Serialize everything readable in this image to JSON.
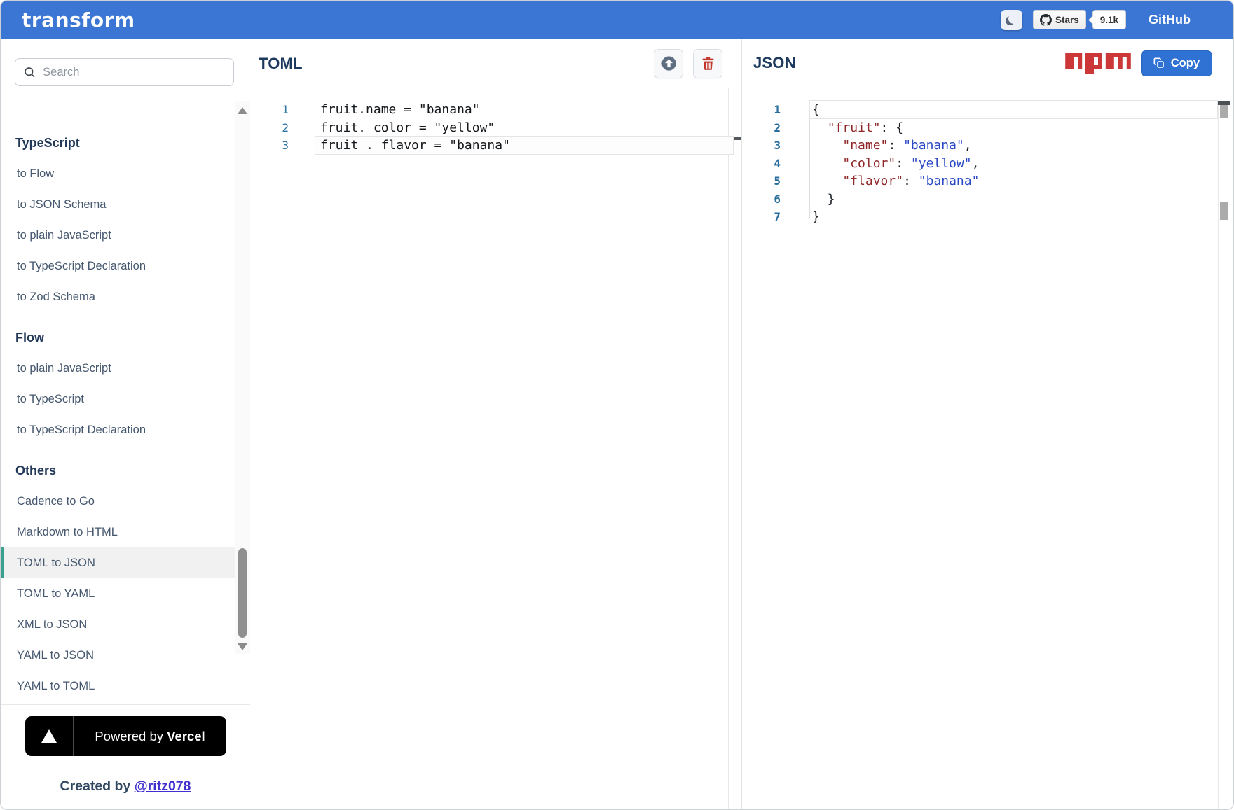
{
  "header": {
    "logo_text": "transform",
    "stars_label": "Stars",
    "stars_count": "9.1k",
    "github_label": "GitHub"
  },
  "sidebar": {
    "search": {
      "placeholder": "Search",
      "value": ""
    },
    "selected_item": "TOML to JSON",
    "sections": [
      {
        "title": "TypeScript",
        "items": [
          "to Flow",
          "to JSON Schema",
          "to plain JavaScript",
          "to TypeScript Declaration",
          "to Zod Schema"
        ]
      },
      {
        "title": "Flow",
        "items": [
          "to plain JavaScript",
          "to TypeScript",
          "to TypeScript Declaration"
        ]
      },
      {
        "title": "Others",
        "items": [
          "Cadence to Go",
          "Markdown to HTML",
          "TOML to JSON",
          "TOML to YAML",
          "XML to JSON",
          "YAML to JSON",
          "YAML to TOML"
        ]
      }
    ],
    "footer": {
      "powered_prefix": "Powered by ",
      "powered_brand": "Vercel",
      "created_prefix": "Created by ",
      "author_link": "@ritz078"
    }
  },
  "toml_panel": {
    "title": "TOML",
    "tools": [
      "upload-icon",
      "trash-icon"
    ],
    "active_line": 3,
    "lines": [
      {
        "num": "1",
        "code": "fruit.name = \"banana\""
      },
      {
        "num": "2",
        "code": "fruit. color = \"yellow\""
      },
      {
        "num": "3",
        "code": "fruit . flavor = \"banana\""
      }
    ]
  },
  "json_panel": {
    "title": "JSON",
    "logo": "npm-logo",
    "copy_label": "Copy",
    "active_line": 1,
    "lines": [
      {
        "num": "1",
        "tokens": [
          {
            "t": "p",
            "v": "{"
          }
        ]
      },
      {
        "num": "2",
        "tokens": [
          {
            "t": "p",
            "v": "  "
          },
          {
            "t": "k",
            "v": "\"fruit\""
          },
          {
            "t": "p",
            "v": ": {"
          }
        ]
      },
      {
        "num": "3",
        "tokens": [
          {
            "t": "p",
            "v": "    "
          },
          {
            "t": "k",
            "v": "\"name\""
          },
          {
            "t": "p",
            "v": ": "
          },
          {
            "t": "s",
            "v": "\"banana\""
          },
          {
            "t": "p",
            "v": ","
          }
        ]
      },
      {
        "num": "4",
        "tokens": [
          {
            "t": "p",
            "v": "    "
          },
          {
            "t": "k",
            "v": "\"color\""
          },
          {
            "t": "p",
            "v": ": "
          },
          {
            "t": "s",
            "v": "\"yellow\""
          },
          {
            "t": "p",
            "v": ","
          }
        ]
      },
      {
        "num": "5",
        "tokens": [
          {
            "t": "p",
            "v": "    "
          },
          {
            "t": "k",
            "v": "\"flavor\""
          },
          {
            "t": "p",
            "v": ": "
          },
          {
            "t": "s",
            "v": "\"banana\""
          }
        ]
      },
      {
        "num": "6",
        "tokens": [
          {
            "t": "p",
            "v": "  }"
          }
        ]
      },
      {
        "num": "7",
        "tokens": [
          {
            "t": "p",
            "v": "}"
          }
        ]
      }
    ]
  },
  "colors": {
    "header_bg": "#3c76d4",
    "copy_button": "#2f72d4",
    "npm_red": "#cb3837",
    "trash_red": "#c23528",
    "selected_accent": "#3aa08f",
    "json_key": "#8f2628",
    "json_string": "#2b49c5",
    "gutter_blue": "#2e74a0"
  }
}
